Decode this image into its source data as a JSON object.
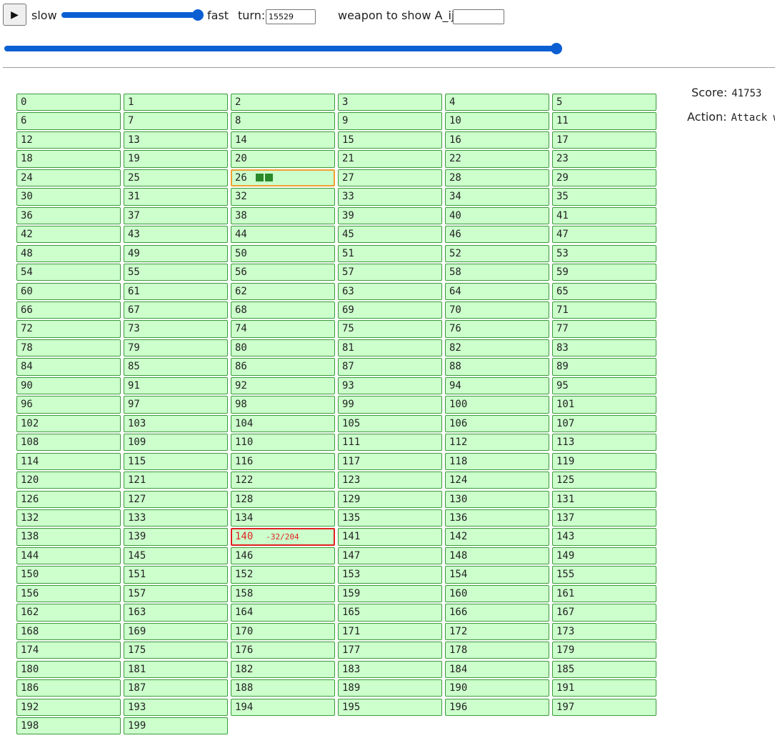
{
  "controls": {
    "play_icon": "play-icon",
    "play_glyph": "▶",
    "slow_label": "slow",
    "fast_label": "fast",
    "turn_label": "turn:",
    "turn_value": "15529",
    "weapon_label": "weapon to show A_ij:",
    "weapon_value": "",
    "speed_level": 1.0,
    "turn_progress": 1.0
  },
  "info": {
    "score_label": "Score:",
    "score_value": "41753",
    "action_label": "Action:",
    "action_value": "Attack w"
  },
  "grid": {
    "count": 200,
    "highlighted": [
      {
        "index": 26,
        "style": "orange",
        "blocks": 2
      },
      {
        "index": 140,
        "style": "red",
        "extra": "-32/204"
      }
    ]
  },
  "colors": {
    "cell_bg": "#ccffcc",
    "cell_border": "#3a9a3a",
    "highlight_orange": "#f0a030",
    "highlight_red": "#e02020",
    "slider_accent": "#0b5fd3"
  }
}
